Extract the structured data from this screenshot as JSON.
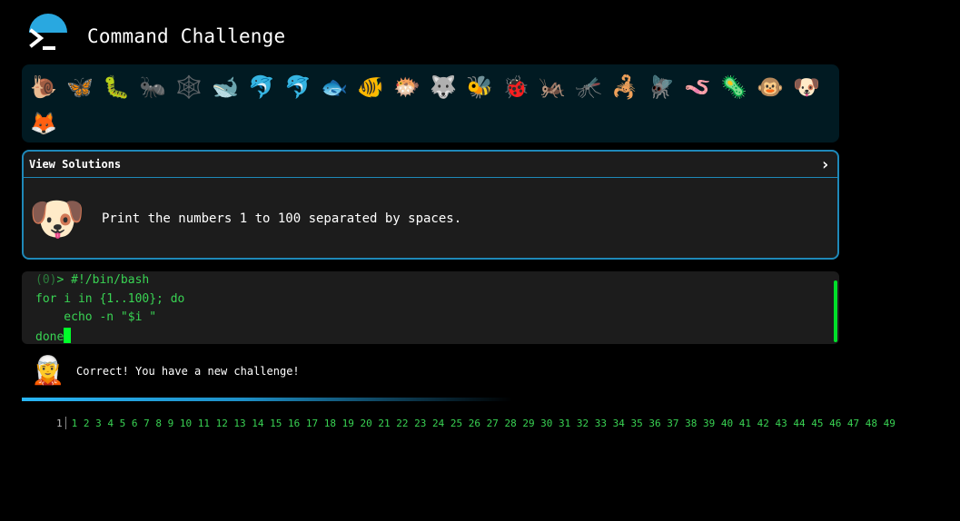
{
  "app": {
    "title": "Command Challenge"
  },
  "critters": [
    "🐌",
    "🦋",
    "🐛",
    "🐜",
    "🕸️",
    "🐋",
    "🐬",
    "🐬",
    "🐟",
    "🐠",
    "🐡",
    "🐺",
    "🐝",
    "🐞",
    "🦗",
    "🦟",
    "🦂",
    "🪰",
    "🪱",
    "🦠",
    "🐵",
    "🐶",
    "🦊"
  ],
  "challenge": {
    "solutions_label": "View Solutions",
    "chevron": "›",
    "avatar": "🐶",
    "text": "Print the numbers 1 to 100 separated by spaces."
  },
  "terminal": {
    "prompt_number": "(0)",
    "prompt_symbol": ">",
    "lines": [
      " #!/bin/bash",
      "for i in {1..100}; do",
      "    echo -n \"$i \"",
      "done"
    ]
  },
  "feedback": {
    "avatar": "🧝",
    "text": "Correct! You have a new challenge!"
  },
  "output": {
    "line_number": "1",
    "text": "1 2 3 4 5 6 7 8 9 10 11 12 13 14 15 16 17 18 19 20 21 22 23 24 25 26 27 28 29 30 31 32 33 34 35 36 37 38 39 40 41 42 43 44 45 46 47 48 49"
  },
  "colors": {
    "accent": "#1e88b8",
    "terminal_text": "#39d353",
    "cursor": "#00ff2a",
    "panel_bg": "#1c1c1c",
    "emoji_bar_bg": "#011a22"
  }
}
